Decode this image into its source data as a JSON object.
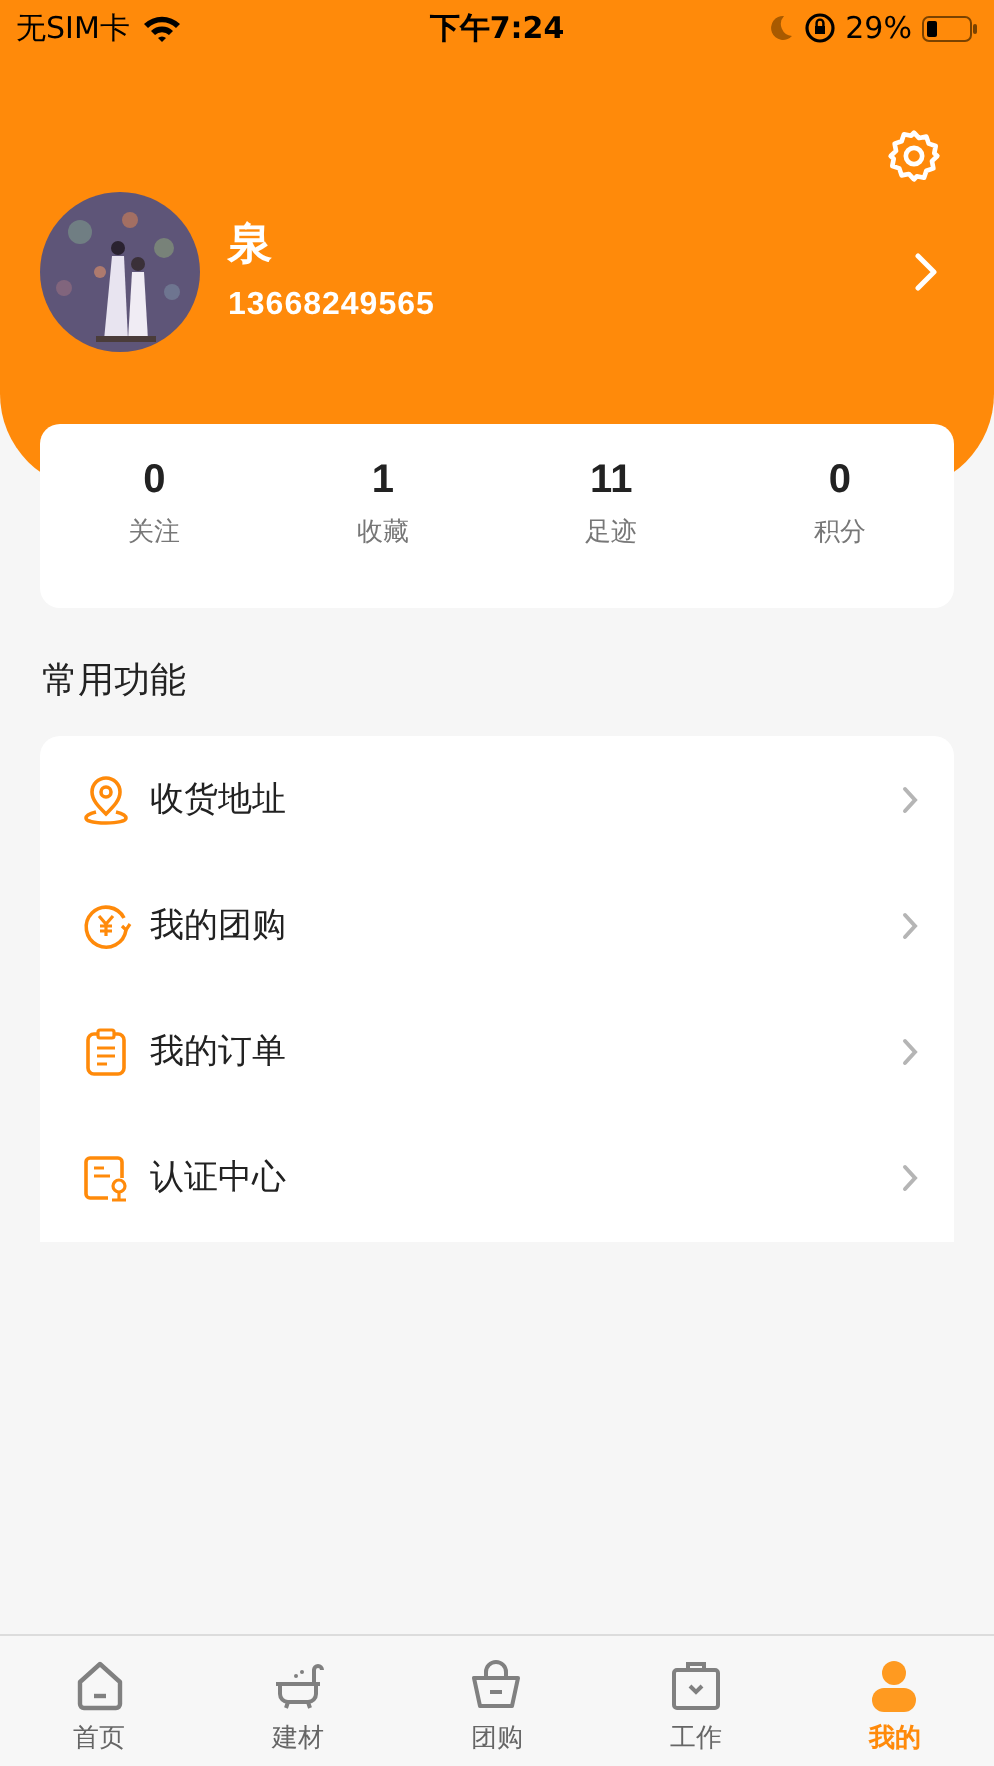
{
  "status_bar": {
    "carrier": "无SIM卡",
    "time": "下午7:24",
    "battery": "29%"
  },
  "profile": {
    "name": "泉",
    "phone": "13668249565"
  },
  "stats": [
    {
      "value": "0",
      "label": "关注"
    },
    {
      "value": "1",
      "label": "收藏"
    },
    {
      "value": "11",
      "label": "足迹"
    },
    {
      "value": "0",
      "label": "积分"
    }
  ],
  "section_title": "常用功能",
  "menu": [
    {
      "kind": "location",
      "label": "收货地址"
    },
    {
      "kind": "group-buy",
      "label": "我的团购"
    },
    {
      "kind": "order",
      "label": "我的订单"
    },
    {
      "kind": "certify",
      "label": "认证中心"
    }
  ],
  "tab_bar": [
    {
      "kind": "home",
      "label": "首页",
      "selected": false
    },
    {
      "kind": "bathtub",
      "label": "建材",
      "selected": false
    },
    {
      "kind": "basket",
      "label": "团购",
      "selected": false
    },
    {
      "kind": "briefcase",
      "label": "工作",
      "selected": false
    },
    {
      "kind": "person",
      "label": "我的",
      "selected": true
    }
  ]
}
